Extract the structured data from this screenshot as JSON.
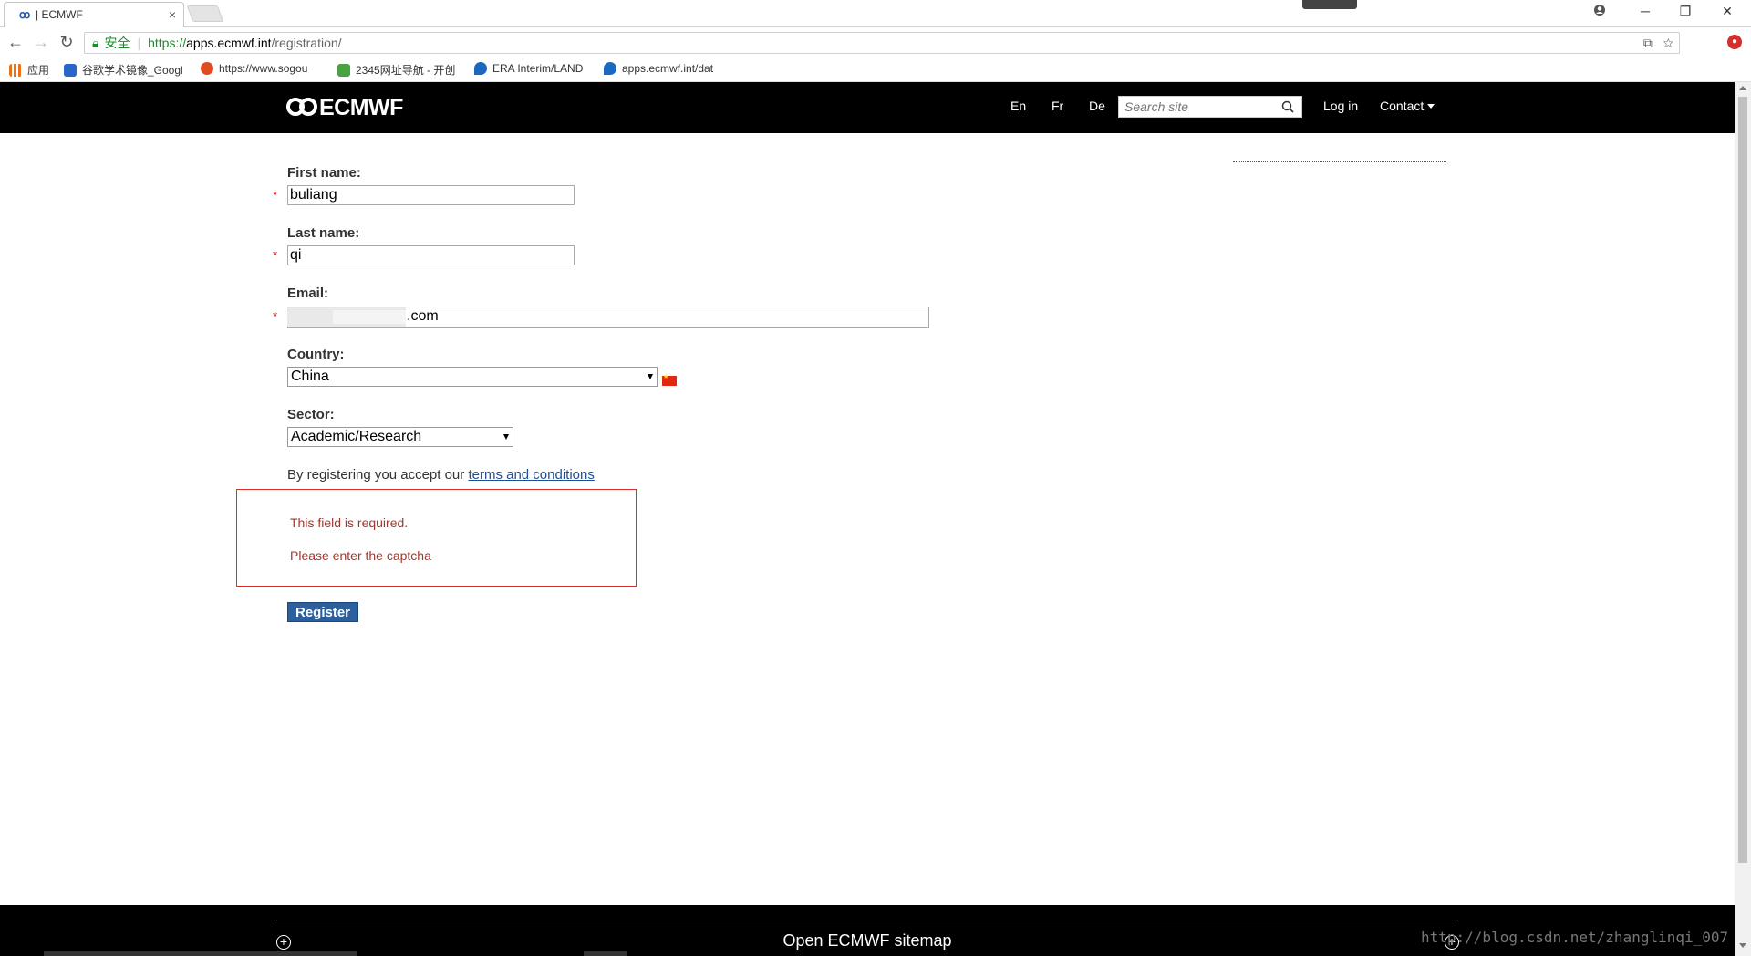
{
  "browser": {
    "tab_title": "| ECMWF",
    "tab_close": "×",
    "secure_label": "安全",
    "url_scheme": "https://",
    "url_host": "apps.ecmwf.int",
    "url_path": "/registration/",
    "bookmarks": [
      {
        "label": "应用",
        "color": "#e8711a"
      },
      {
        "label": "谷歌学术镜像_Googl",
        "color": "#2a66c9"
      },
      {
        "label": "https://www.sogou",
        "color": "#e04a1f"
      },
      {
        "label": "2345网址导航 - 开创",
        "color": "#47a23f"
      },
      {
        "label": "ERA Interim/LAND",
        "color": "#1a68c0"
      },
      {
        "label": "apps.ecmwf.int/dat",
        "color": "#1a68c0"
      }
    ]
  },
  "header": {
    "logo": "ECMWF",
    "languages": [
      "En",
      "Fr",
      "De"
    ],
    "search_placeholder": "Search site",
    "login": "Log in",
    "contact": "Contact"
  },
  "form": {
    "first_name_label": "First name:",
    "first_name_value": "buliang",
    "last_name_label": "Last name:",
    "last_name_value": "qi",
    "email_label": "Email:",
    "email_value": ".com",
    "country_label": "Country:",
    "country_value": "China",
    "sector_label": "Sector:",
    "sector_value": "Academic/Research",
    "required_mark": "*",
    "terms_prefix": "By registering you accept our ",
    "terms_link": "terms and conditions",
    "errors": [
      "This field is required.",
      "Please enter the captcha"
    ],
    "register_button": "Register"
  },
  "footer": {
    "sitemap": "Open ECMWF sitemap"
  },
  "watermark": "http://blog.csdn.net/zhanglinqi_007",
  "colors": {
    "header_bg": "#000000",
    "error_border": "#d9302c",
    "error_text": "#a4372a",
    "button_bg": "#2b5f9e",
    "link": "#1f4e96"
  }
}
